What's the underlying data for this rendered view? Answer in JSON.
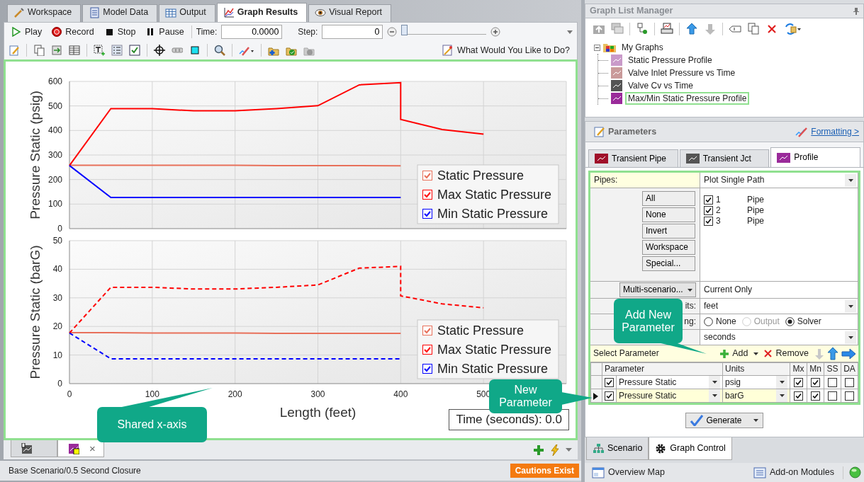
{
  "tabs": [
    {
      "label": "Workspace",
      "selected": false
    },
    {
      "label": "Model Data",
      "selected": false
    },
    {
      "label": "Output",
      "selected": false
    },
    {
      "label": "Graph Results",
      "selected": true
    },
    {
      "label": "Visual Report",
      "selected": false
    }
  ],
  "playback": {
    "buttons": [
      "Play",
      "Record",
      "Stop",
      "Pause"
    ],
    "time_label": "Time:",
    "time_value": "0.0000",
    "step_label": "Step:",
    "step_value": "0",
    "slider": {
      "level": 0
    }
  },
  "toolbar": {
    "help": "What Would You Like to Do?"
  },
  "charts": [
    {
      "chart_data": {
        "type": "line",
        "ylabel": "Pressure Static (psig)",
        "xlim": [
          0,
          600
        ],
        "ylim": [
          0,
          600
        ],
        "yticks": [
          0,
          100,
          200,
          300,
          400,
          500,
          600
        ],
        "grid": true,
        "legend": true,
        "x": [
          0,
          50,
          100,
          150,
          200,
          250,
          300,
          350,
          400,
          400,
          450,
          500
        ],
        "series": [
          {
            "name": "Static Pressure",
            "color": "#e8705a",
            "line_style": "solid",
            "values": [
              258,
              258,
              258,
              258,
              258,
              257,
              257,
              257,
              256,
              256,
              null,
              null
            ]
          },
          {
            "name": "Max Static Pressure",
            "color": "#ff0000",
            "line_style": "solid",
            "values": [
              257,
              489,
              489,
              480,
              480,
              489,
              501,
              586,
              595,
              445,
              404,
              385
            ]
          },
          {
            "name": "Min Static Pressure",
            "color": "#0000ff",
            "line_style": "solid",
            "values": [
              257,
              127,
              127,
              127,
              127,
              127,
              127,
              127,
              127,
              127,
              null,
              null
            ]
          }
        ]
      },
      "legend_checks": [
        true,
        true,
        true
      ]
    },
    {
      "chart_data": {
        "type": "line",
        "xlabel": "Length (feet)",
        "ylabel": "Pressure Static (barG)",
        "xlim": [
          0,
          600
        ],
        "ylim": [
          0,
          50
        ],
        "xticks": [
          0,
          100,
          200,
          300,
          400,
          500
        ],
        "yticks": [
          0,
          10,
          20,
          30,
          40,
          50
        ],
        "grid": true,
        "legend": true,
        "x": [
          0,
          50,
          100,
          150,
          200,
          250,
          300,
          350,
          400,
          400,
          450,
          500
        ],
        "series": [
          {
            "name": "Static Pressure",
            "color": "#e8705a",
            "line_style": "solid",
            "values": [
              17.8,
              17.8,
              17.7,
              17.7,
              17.7,
              17.6,
              17.6,
              17.6,
              17.6,
              17.6,
              null,
              null
            ]
          },
          {
            "name": "Max Static Pressure",
            "color": "#ff0000",
            "line_style": "dashed",
            "values": [
              17.7,
              33.7,
              33.7,
              33.1,
              33.1,
              33.7,
              34.5,
              40.4,
              41.0,
              30.7,
              27.9,
              26.5
            ]
          },
          {
            "name": "Min Static Pressure",
            "color": "#0000ff",
            "line_style": "dashed",
            "values": [
              17.7,
              8.7,
              8.7,
              8.7,
              8.7,
              8.7,
              8.7,
              8.7,
              8.7,
              8.7,
              null,
              null
            ]
          }
        ]
      },
      "legend_checks": [
        true,
        true,
        true
      ]
    }
  ],
  "time_box": "Time (seconds): 0.0",
  "graph_tabs": [
    {
      "selected": false
    },
    {
      "selected": true,
      "close": "×"
    }
  ],
  "status": {
    "scenario": "Base Scenario/0.5 Second Closure",
    "cautions": "Cautions Exist"
  },
  "graph_list": {
    "title": "Graph List Manager",
    "root": {
      "label": "My Graphs",
      "expanded": true,
      "children": [
        {
          "label": "Static Pressure Profile",
          "selected": false
        },
        {
          "label": "Valve Inlet Pressure vs Time",
          "selected": false
        },
        {
          "label": "Valve Cv vs Time",
          "selected": false
        },
        {
          "label": "Max/Min Static Pressure Profile",
          "selected": true
        }
      ]
    }
  },
  "parameters": {
    "title": "Parameters",
    "formatting": "Formatting >",
    "tabs": [
      {
        "label": "Transient Pipe",
        "selected": false
      },
      {
        "label": "Transient Jct",
        "selected": false
      },
      {
        "label": "Profile",
        "selected": true
      }
    ],
    "pipes_label": "Pipes:",
    "pipes_mode": "Plot Single Path",
    "pipe_buttons": [
      "All",
      "None",
      "Invert",
      "Workspace",
      "Special..."
    ],
    "pipes": [
      {
        "id": "1",
        "type": "Pipe",
        "checked": true
      },
      {
        "id": "2",
        "type": "Pipe",
        "checked": true
      },
      {
        "id": "3",
        "type": "Pipe",
        "checked": true
      }
    ],
    "multi_button": "Multi-scenario...",
    "multi_value": "Current Only",
    "rows": [
      {
        "kind": "dropdown",
        "label": "its:",
        "value": "feet"
      },
      {
        "kind": "radio",
        "label": "ng:",
        "options": [
          {
            "label": "None",
            "selected": false,
            "disabled": false
          },
          {
            "label": "Output",
            "selected": false,
            "disabled": true
          },
          {
            "label": "Solver",
            "selected": true,
            "disabled": false
          }
        ]
      },
      {
        "kind": "dropdown",
        "value": "seconds"
      }
    ],
    "select_label": "Select Parameter",
    "add": "Add",
    "remove": "Remove",
    "table": {
      "columns": [
        "Parameter",
        "Units",
        "Mx",
        "Mn",
        "SS",
        "DA"
      ],
      "rows": [
        {
          "selected": false,
          "checked": true,
          "parameter": "Pressure Static",
          "units": "psig",
          "mx": true,
          "mn": true,
          "ss": false,
          "da": false
        },
        {
          "selected": true,
          "checked": true,
          "parameter": "Pressure Static",
          "units": "barG",
          "mx": true,
          "mn": true,
          "ss": false,
          "da": false
        }
      ]
    },
    "generate": "Generate"
  },
  "bottom_tabs": [
    {
      "label": "Scenario",
      "selected": false
    },
    {
      "label": "Graph Control",
      "selected": true
    }
  ],
  "footer": {
    "overview": "Overview Map",
    "addons": "Add-on Modules"
  },
  "callouts": [
    {
      "text": "Add New Parameter"
    },
    {
      "text": "New Parameter"
    },
    {
      "text": "Shared x-axis"
    }
  ]
}
